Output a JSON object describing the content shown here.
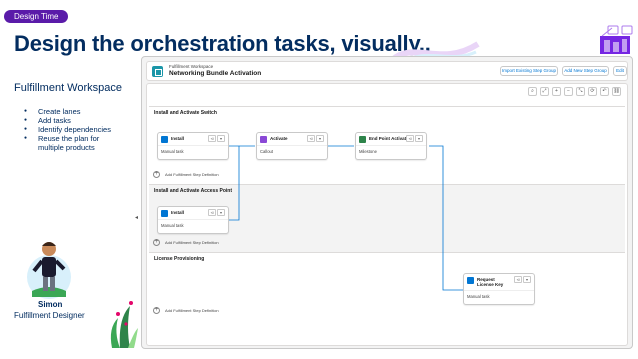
{
  "slide": {
    "pill": "Design Time",
    "title": "Design the orchestration tasks, visually..",
    "left_title": "Fulfillment Workspace",
    "bullets": [
      "Create lanes",
      "Add tasks",
      "Identify dependencies",
      "Reuse the plan for multiple products"
    ],
    "person": {
      "name": "Simon",
      "role": "Fulfillment Designer"
    }
  },
  "app": {
    "workspace_label": "Fulfillment Workspace",
    "workspace_name": "Networking Bundle Activation",
    "buttons": [
      "Import Existing Step Group",
      "Add New Step Group",
      "Edit"
    ],
    "toolbar_icons": [
      "search-icon",
      "fit-icon",
      "zoom-in-icon",
      "zoom-out-icon",
      "expand-icon",
      "refresh-icon",
      "undo-icon",
      "link-icon"
    ],
    "toolbar_glyphs": [
      "⌕",
      "⤢",
      "+",
      "−",
      "⤡",
      "⟳",
      "↶",
      "⛓"
    ],
    "add_step_label": "Add Fulfillment Step Definition",
    "lanes": [
      {
        "title": "Install and Activate Switch"
      },
      {
        "title": "Install and Activate Access Point"
      },
      {
        "title": "License Provisioning"
      }
    ],
    "nodes": [
      {
        "name": "Install",
        "type": "Manual task",
        "color": "#0176d3"
      },
      {
        "name": "Activate",
        "type": "Callout",
        "color": "#8a48d6"
      },
      {
        "name": "End Point Activated",
        "type": "Milestone",
        "color": "#2e844a"
      },
      {
        "name": "Install",
        "type": "Manual task",
        "color": "#0176d3"
      },
      {
        "name": "Request License Key",
        "type": "Manual task",
        "color": "#0176d3"
      }
    ],
    "connector_color": "#0176d3"
  }
}
